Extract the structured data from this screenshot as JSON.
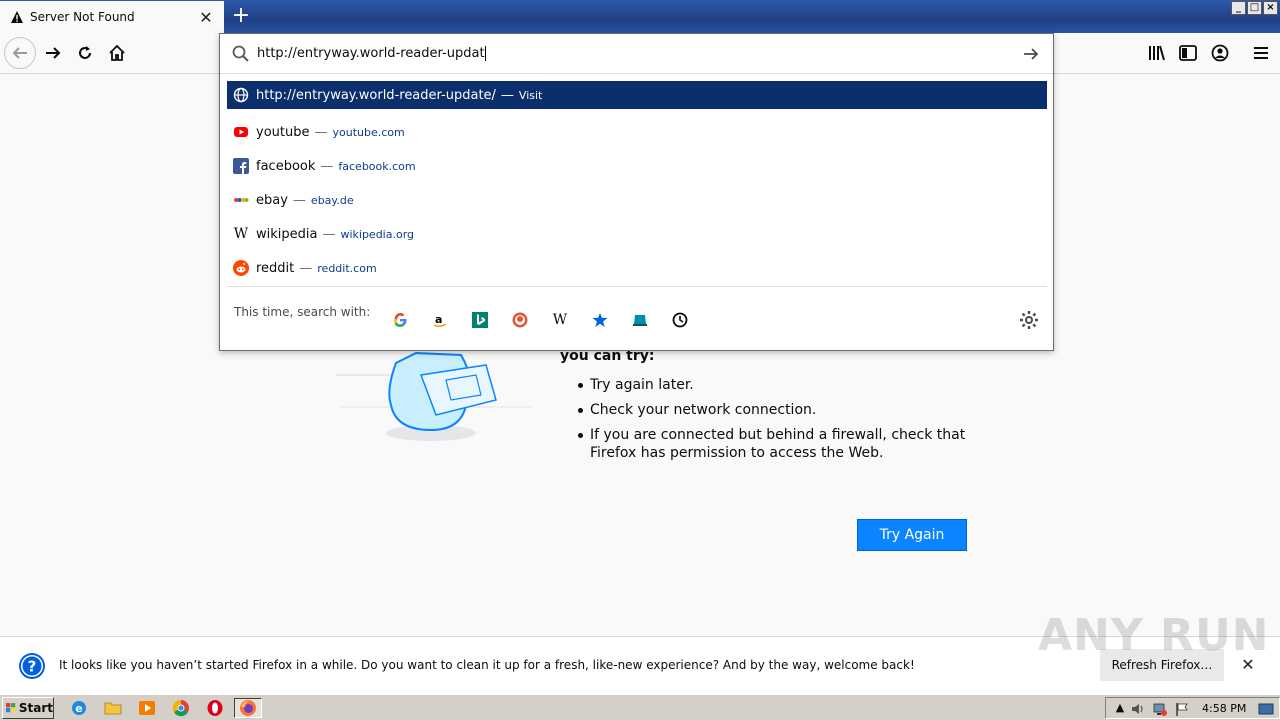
{
  "tab": {
    "title": "Server Not Found",
    "new_tab_label": "+"
  },
  "window_buttons": [
    "_",
    "□",
    "×"
  ],
  "urlbar": {
    "value": "http://entryway.world-reader-updat",
    "results": [
      {
        "title": "http://entryway.world-reader-update/",
        "url": "Visit",
        "icon": "globe-icon",
        "selected": true
      },
      {
        "title": "youtube",
        "url": "youtube.com",
        "icon": "youtube-icon",
        "selected": false
      },
      {
        "title": "facebook",
        "url": "facebook.com",
        "icon": "facebook-icon",
        "selected": false
      },
      {
        "title": "ebay",
        "url": "ebay.de",
        "icon": "ebay-icon",
        "selected": false
      },
      {
        "title": "wikipedia",
        "url": "wikipedia.org",
        "icon": "wikipedia-icon",
        "selected": false
      },
      {
        "title": "reddit",
        "url": "reddit.com",
        "icon": "reddit-icon",
        "selected": false
      }
    ],
    "search_with_label": "This time, search with:",
    "engines": [
      "google-icon",
      "amazon-icon",
      "bing-icon",
      "duckduckgo-icon",
      "wikipedia-icon",
      "bookmarks-icon",
      "tabs-icon",
      "history-icon"
    ]
  },
  "error_page": {
    "heading": "you can try:",
    "bullets": [
      "Try again later.",
      "Check your network connection.",
      "If you are connected but behind a firewall, check that Firefox has permission to access the Web."
    ],
    "try_again_label": "Try Again"
  },
  "notification": {
    "message": "It looks like you haven’t started Firefox in a while. Do you want to clean it up for a fresh, like-new experience? And by the way, welcome back!",
    "refresh_label": "Refresh Firefox…",
    "close_label": "✕"
  },
  "watermark": "ANY RUN",
  "taskbar": {
    "start_label": "Start",
    "clock": "4:58 PM"
  },
  "colors": {
    "accent": "#0a84ff",
    "selected_row": "#0a2f6c",
    "titlebar": "#1f3f85"
  }
}
